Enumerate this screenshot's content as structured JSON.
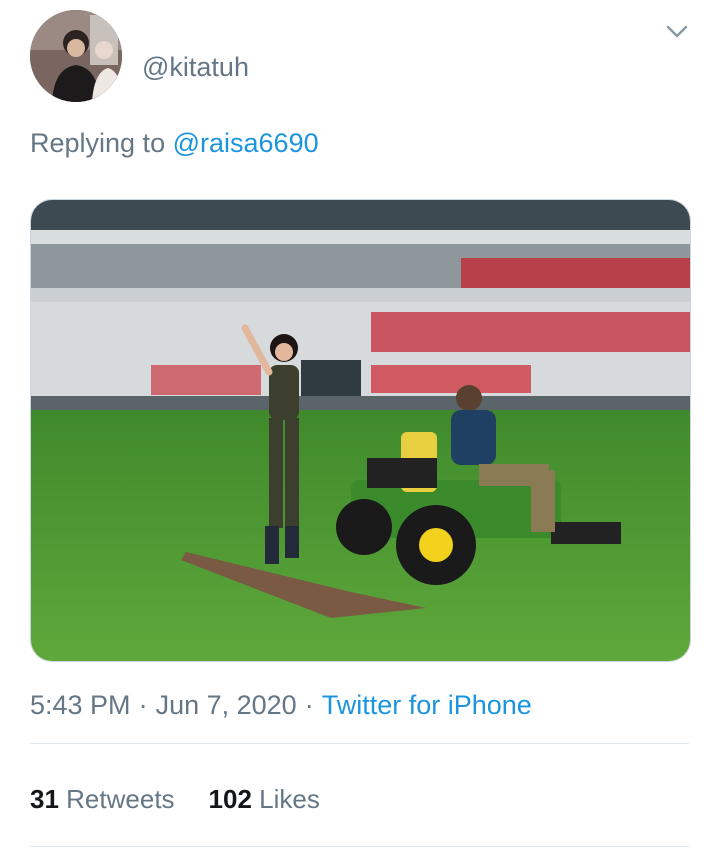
{
  "tweet": {
    "handle": "@kitatuh",
    "reply_prefix": "Replying to",
    "reply_to": "@raisa6690",
    "time": "5:43 PM",
    "date": "Jun 7, 2020",
    "separator": "·",
    "source": "Twitter for iPhone",
    "retweets": {
      "count": "31",
      "label": "Retweets"
    },
    "likes": {
      "count": "102",
      "label": "Likes"
    }
  },
  "icons": {
    "menu": "chevron-down-icon"
  },
  "colors": {
    "link": "#1b95e0",
    "muted": "#657786",
    "text": "#14171a",
    "divider": "#e1e8ed"
  }
}
